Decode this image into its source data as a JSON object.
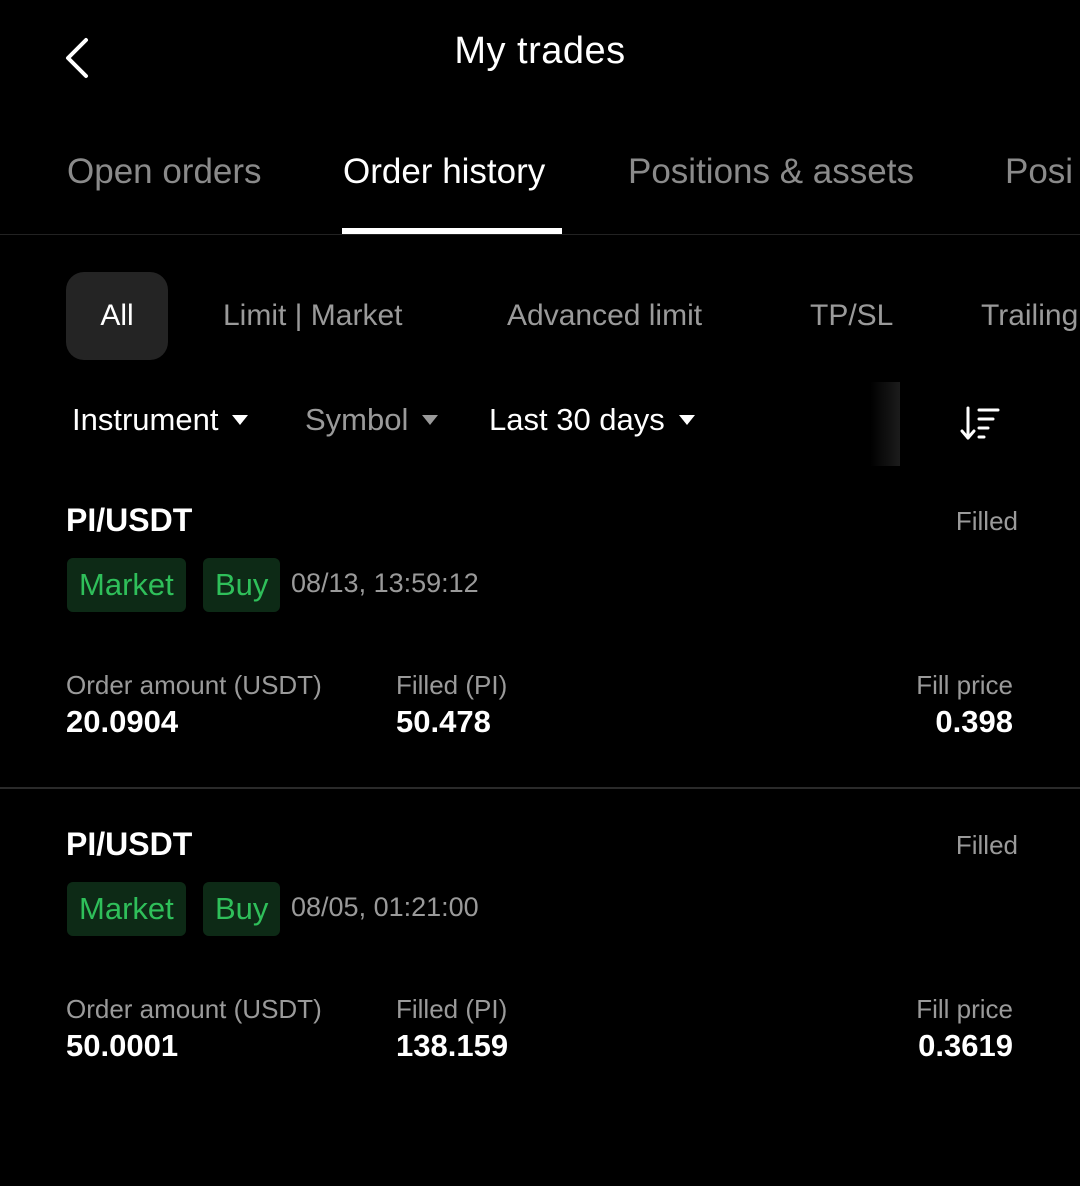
{
  "header": {
    "title": "My trades",
    "back_icon": "chevron-left-icon"
  },
  "tabs": [
    {
      "label": "Open orders",
      "active": false
    },
    {
      "label": "Order history",
      "active": true
    },
    {
      "label": "Positions & assets",
      "active": false
    },
    {
      "label": "Posi",
      "active": false
    }
  ],
  "chips": [
    {
      "label": "All",
      "active": true
    },
    {
      "label": "Limit | Market",
      "active": false
    },
    {
      "label": "Advanced limit",
      "active": false
    },
    {
      "label": "TP/SL",
      "active": false
    },
    {
      "label": "Trailing",
      "active": false
    }
  ],
  "filters": {
    "instrument": "Instrument",
    "symbol": "Symbol",
    "period": "Last 30 days",
    "sort_icon": "sort-descending-icon"
  },
  "orders": [
    {
      "pair": "PI/USDT",
      "status": "Filled",
      "type": "Market",
      "side": "Buy",
      "time": "08/13, 13:59:12",
      "amount_label": "Order amount (USDT)",
      "amount": "20.0904",
      "filled_label": "Filled (PI)",
      "filled": "50.478",
      "price_label": "Fill price",
      "price": "0.398"
    },
    {
      "pair": "PI/USDT",
      "status": "Filled",
      "type": "Market",
      "side": "Buy",
      "time": "08/05, 01:21:00",
      "amount_label": "Order amount (USDT)",
      "amount": "50.0001",
      "filled_label": "Filled (PI)",
      "filled": "138.159",
      "price_label": "Fill price",
      "price": "0.3619"
    }
  ],
  "colors": {
    "background": "#000000",
    "badge_bg": "#0d2a16",
    "badge_text": "#2fbf5a",
    "muted_text": "#9a9a9a"
  }
}
